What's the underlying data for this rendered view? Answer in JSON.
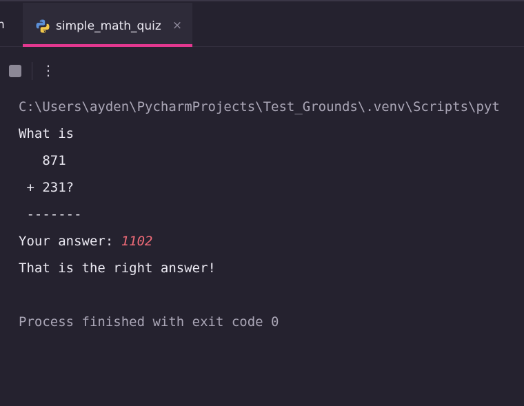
{
  "tabs": {
    "partial_tab_text": "n",
    "active": {
      "label": "simple_math_quiz",
      "icon": "python-icon",
      "close": "×"
    }
  },
  "toolbar": {
    "stop_icon": "stop-icon",
    "more_glyph": "⋮"
  },
  "console": {
    "command": "C:\\Users\\ayden\\PycharmProjects\\Test_Grounds\\.venv\\Scripts\\pyt",
    "question": "What is",
    "operand1": "   871",
    "operand2": " + 231?",
    "separator": " -------",
    "prompt": "Your answer: ",
    "answer": "1102",
    "result": "That is the right answer!",
    "exit": "Process finished with exit code 0"
  },
  "colors": {
    "background": "#25222f",
    "tab_active_bg": "#2e2b39",
    "tab_underline": "#e2388f",
    "input_text": "#f06b78",
    "dim_text": "#aaa6b6"
  }
}
